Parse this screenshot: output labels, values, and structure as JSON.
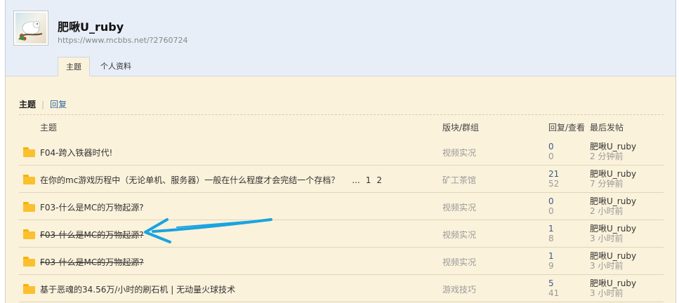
{
  "profile": {
    "username": "肥啾U_ruby",
    "url": "https://www.mcbbs.net/?2760724"
  },
  "tabs": {
    "threads": "主题",
    "profile": "个人资料"
  },
  "subnav": {
    "threads": "主题",
    "separator": "|",
    "replies": "回复"
  },
  "columns": {
    "topic": "主题",
    "forum": "版块/群组",
    "stats": "回复/查看",
    "last_post": "最后发帖"
  },
  "threads": [
    {
      "title": "F04-跨入铁器时代!",
      "forum": "视频实况",
      "replies": "0",
      "views": "0",
      "last_user": "肥啾U_ruby",
      "last_time": "2 分钟前"
    },
    {
      "title": "在你的mc游戏历程中（无论单机、服务器）一般在什么程度才会完结一个存档？",
      "pages": [
        "...",
        "1",
        "2"
      ],
      "forum": "矿工茶馆",
      "replies": "21",
      "views": "52",
      "last_user": "肥啾U_ruby",
      "last_time": "7 分钟前"
    },
    {
      "title": "F03-什么是MC的万物起源?",
      "forum": "视频实况",
      "replies": "0",
      "views": "0",
      "last_user": "肥啾U_ruby",
      "last_time": "2 小时前"
    },
    {
      "title": "F03-什么是MC的万物起源?",
      "forum": "视频实况",
      "replies": "1",
      "views": "8",
      "last_user": "肥啾U_ruby",
      "last_time": "3 小时前"
    },
    {
      "title": "F03-什么是MC的万物起源?",
      "forum": "视频实况",
      "replies": "1",
      "views": "9",
      "last_user": "肥啾U_ruby",
      "last_time": "3 小时前"
    },
    {
      "title": "基于恶魂的34.56万/小时的刷石机 | 无动量火球技术",
      "forum": "游戏技巧",
      "replies": "5",
      "views": "41",
      "last_user": "肥啾U_ruby",
      "last_time": "3 小时前"
    }
  ],
  "colors": {
    "header_bg": "#e8eef7",
    "content_bg": "#fbf2db",
    "folder": "#fbc02d",
    "arrow": "#1aa3e0"
  },
  "icons": {
    "thread_icon": "folder-icon",
    "annotation": "arrow-icon"
  }
}
